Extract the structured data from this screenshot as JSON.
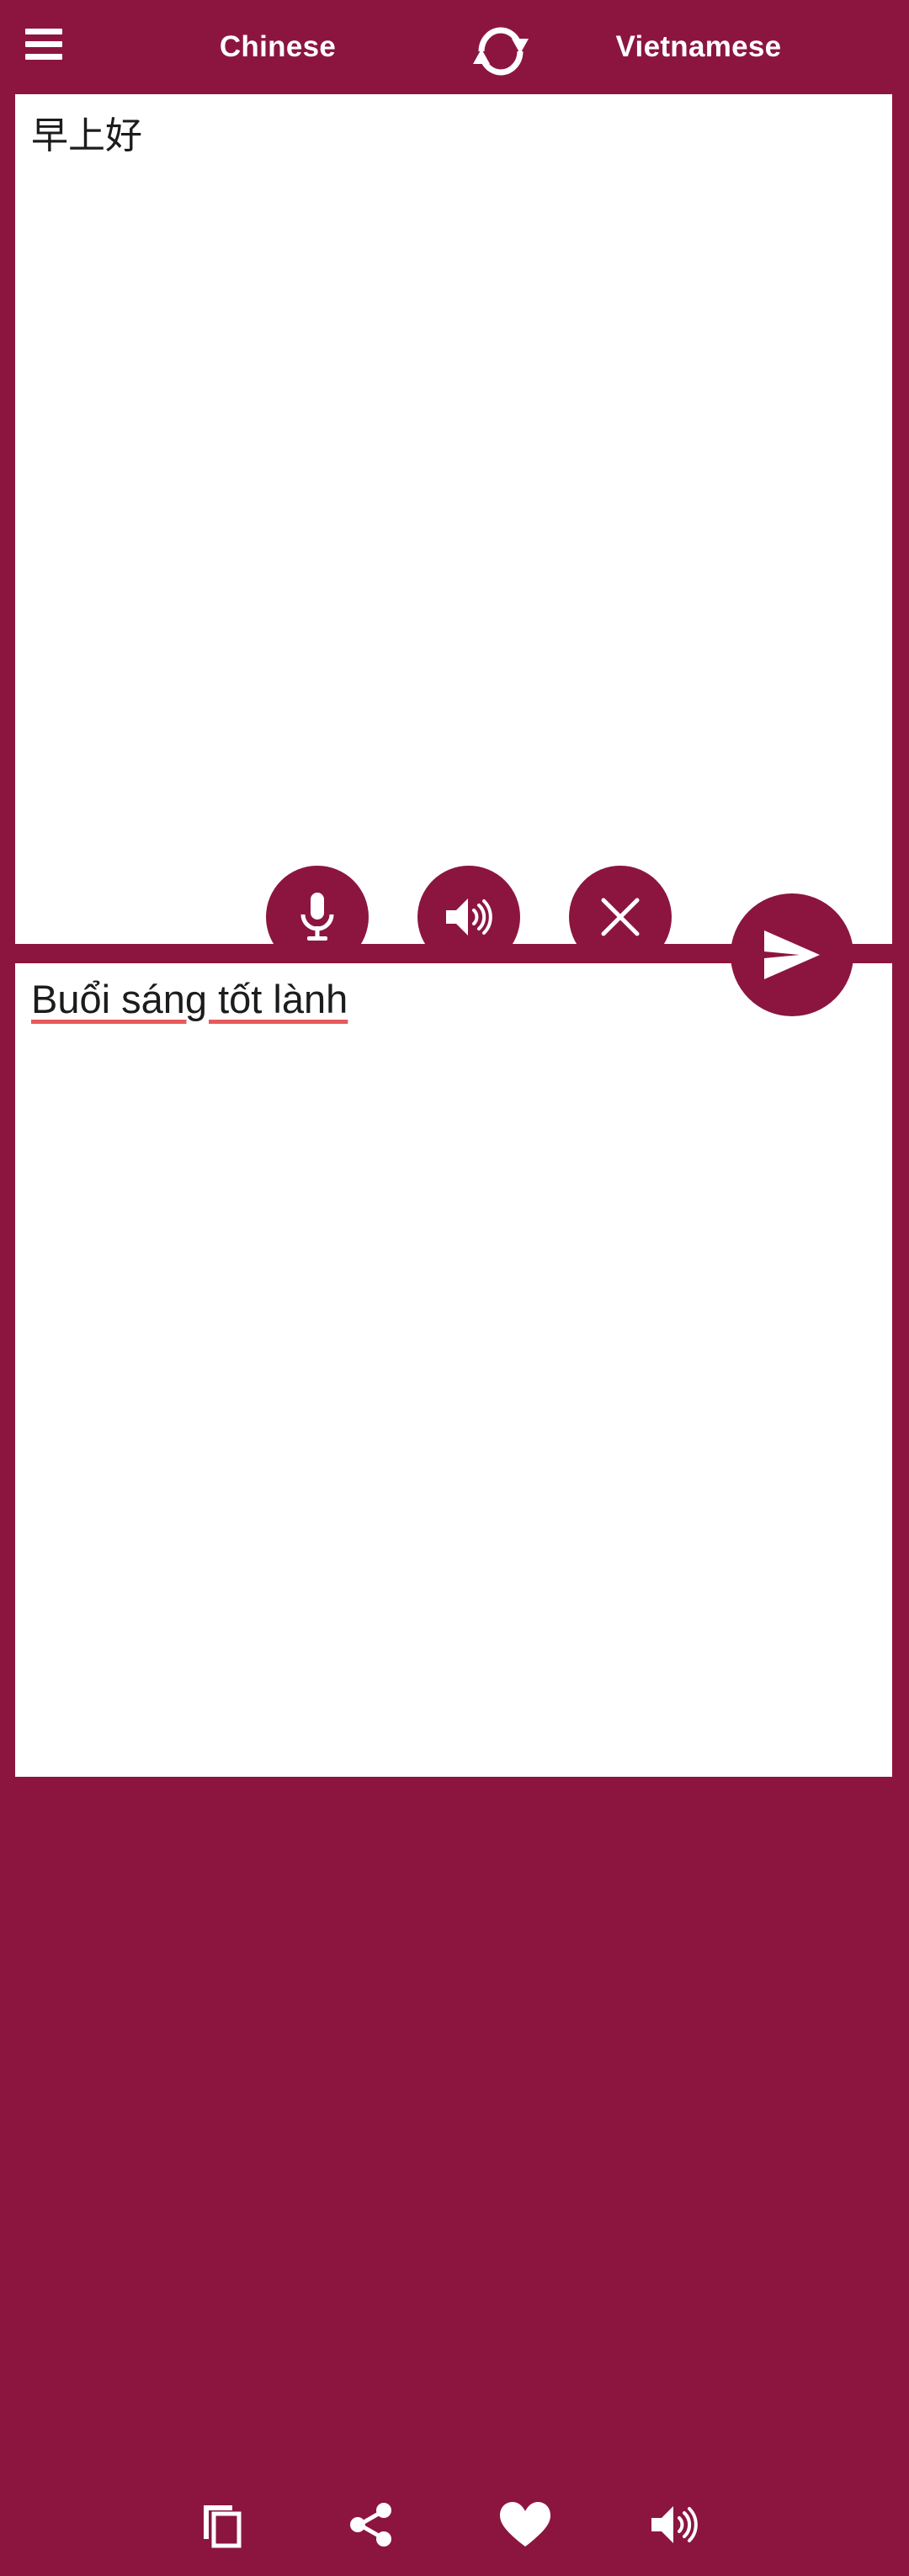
{
  "app": {
    "theme_color": "#8c1540",
    "surface_color": "#ffffff",
    "spellcheck_underline_color": "#e85a5a"
  },
  "topbar": {
    "menu_label": "menu",
    "source_language": "Chinese",
    "target_language": "Vietnamese",
    "swap_label": "swap-languages",
    "icons": {
      "menu": "hamburger-menu-icon",
      "swap": "swap-languages-icon"
    }
  },
  "source_panel": {
    "text": "早上好",
    "placeholder": "",
    "actions": [
      {
        "name": "microphone",
        "icon": "microphone-icon",
        "label": "Voice input"
      },
      {
        "name": "speak-source",
        "icon": "speaker-icon",
        "label": "Listen"
      },
      {
        "name": "clear",
        "icon": "close-icon",
        "label": "Clear"
      }
    ]
  },
  "send": {
    "label": "Translate",
    "icon": "send-icon"
  },
  "target_panel": {
    "text": "Buổi sáng tốt lành",
    "spellchecked_words": [
      "Buổi",
      "sáng",
      "tốt",
      "lành"
    ],
    "actions": [
      {
        "name": "copy",
        "icon": "copy-icon",
        "label": "Copy"
      },
      {
        "name": "share",
        "icon": "share-icon",
        "label": "Share"
      },
      {
        "name": "favorite",
        "icon": "heart-icon",
        "label": "Favorite"
      },
      {
        "name": "speak-target",
        "icon": "speaker-icon",
        "label": "Listen"
      }
    ]
  }
}
